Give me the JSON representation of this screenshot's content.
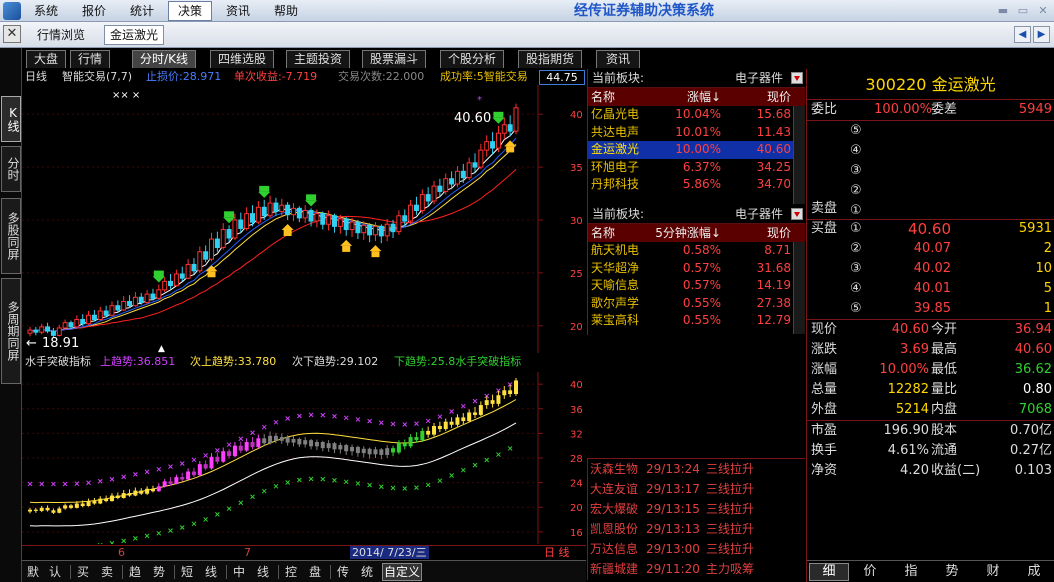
{
  "menubar": {
    "items": [
      "系统",
      "报价",
      "统计",
      "决策",
      "资讯",
      "帮助"
    ],
    "active_index": 3,
    "title": "经传证券辅助决策系统"
  },
  "toolbar": {
    "tabs": [
      "行情浏览",
      "金运激光"
    ],
    "active_index": 1
  },
  "left_tabs": [
    "K线",
    "分时",
    "多股同屏",
    "多周期同屏"
  ],
  "top_tabs": {
    "items": [
      "大盘",
      "行情",
      "分时/K线",
      "四维选股",
      "主题投资",
      "股票漏斗",
      "个股分析",
      "股指期货",
      "资讯"
    ],
    "active_index": 2
  },
  "chart_header": {
    "period": "日线",
    "indicator": "智能交易(7,7)",
    "stop_profit": "止损价:28.971",
    "single_gain": "单次收益:-7.719",
    "trade_count": "交易次数:22.000",
    "success_rate": "成功率:5智能交易",
    "price_box": "44.75"
  },
  "indicator_header": {
    "name": "水手突破指标",
    "up": "上趋势:36.851",
    "sub_up": "次上趋势:33.780",
    "sub_down": "次下趋势:29.102",
    "down": "下趋势:25.8水手突破指标"
  },
  "chart_data": [
    {
      "type": "candlestick",
      "title": "日线",
      "y_ticks": [
        "40",
        "35",
        "30",
        "25",
        "20"
      ],
      "ylim": [
        18,
        42
      ],
      "annotations": {
        "high_label": "40.60",
        "low_label": "18.91",
        "marks": "×× ×"
      },
      "candles": [
        [
          19.3,
          19.6,
          19.0,
          19.9
        ],
        [
          19.6,
          19.4,
          19.1,
          19.9
        ],
        [
          19.4,
          19.9,
          19.2,
          20.2
        ],
        [
          19.9,
          19.5,
          19.3,
          20.3
        ],
        [
          19.5,
          19.1,
          18.9,
          19.8
        ],
        [
          19.1,
          19.8,
          19.0,
          20.1
        ],
        [
          19.8,
          20.3,
          19.6,
          20.6
        ],
        [
          20.3,
          19.9,
          19.7,
          20.5
        ],
        [
          19.9,
          20.6,
          19.8,
          21.0
        ],
        [
          20.6,
          20.2,
          20.0,
          21.1
        ],
        [
          20.2,
          21.0,
          20.1,
          21.4
        ],
        [
          21.0,
          20.6,
          20.4,
          21.5
        ],
        [
          20.6,
          21.4,
          20.5,
          21.8
        ],
        [
          21.4,
          21.0,
          20.8,
          21.9
        ],
        [
          21.0,
          21.9,
          20.9,
          22.3
        ],
        [
          21.9,
          21.5,
          21.3,
          22.4
        ],
        [
          21.5,
          22.3,
          21.4,
          22.8
        ],
        [
          22.3,
          21.9,
          21.7,
          22.9
        ],
        [
          21.9,
          22.7,
          21.8,
          23.2
        ],
        [
          22.7,
          22.2,
          22.0,
          23.1
        ],
        [
          22.2,
          23.0,
          22.0,
          23.4
        ],
        [
          23.0,
          22.6,
          22.4,
          23.5
        ],
        [
          22.6,
          23.4,
          22.5,
          23.9
        ],
        [
          23.4,
          24.2,
          23.2,
          24.6
        ],
        [
          24.2,
          23.8,
          23.5,
          24.9
        ],
        [
          23.8,
          24.9,
          23.7,
          25.3
        ],
        [
          24.9,
          24.5,
          24.2,
          25.6
        ],
        [
          24.5,
          25.8,
          24.4,
          26.3
        ],
        [
          25.8,
          25.2,
          24.9,
          26.4
        ],
        [
          25.2,
          27.0,
          25.0,
          27.5
        ],
        [
          27.0,
          26.3,
          26.0,
          27.6
        ],
        [
          26.3,
          28.2,
          26.1,
          28.8
        ],
        [
          28.2,
          27.4,
          27.0,
          28.9
        ],
        [
          27.4,
          29.1,
          27.2,
          29.7
        ],
        [
          29.1,
          28.3,
          27.9,
          29.5
        ],
        [
          28.3,
          30.0,
          28.1,
          30.6
        ],
        [
          30.0,
          29.2,
          28.8,
          30.7
        ],
        [
          29.2,
          30.6,
          29.0,
          31.2
        ],
        [
          30.6,
          29.8,
          29.4,
          31.4
        ],
        [
          29.8,
          31.2,
          29.6,
          31.8
        ],
        [
          31.2,
          30.4,
          30.0,
          31.9
        ],
        [
          30.4,
          31.6,
          30.2,
          32.3
        ],
        [
          31.6,
          30.8,
          30.4,
          32.1
        ],
        [
          30.8,
          31.4,
          30.3,
          32.0
        ],
        [
          31.4,
          30.5,
          30.0,
          31.7
        ],
        [
          30.5,
          31.1,
          29.9,
          31.6
        ],
        [
          31.1,
          30.2,
          29.8,
          31.3
        ],
        [
          30.2,
          30.9,
          29.7,
          31.4
        ],
        [
          30.9,
          29.9,
          29.4,
          31.1
        ],
        [
          29.9,
          30.6,
          29.3,
          31.0
        ],
        [
          30.6,
          29.6,
          29.1,
          30.8
        ],
        [
          29.6,
          30.4,
          29.0,
          30.9
        ],
        [
          30.4,
          29.4,
          28.8,
          30.6
        ],
        [
          29.4,
          30.1,
          28.7,
          30.5
        ],
        [
          30.1,
          29.1,
          28.5,
          30.3
        ],
        [
          29.1,
          29.8,
          28.4,
          30.2
        ],
        [
          29.8,
          28.8,
          28.2,
          30.0
        ],
        [
          28.8,
          29.5,
          28.1,
          29.9
        ],
        [
          29.5,
          28.6,
          27.9,
          29.7
        ],
        [
          28.6,
          29.4,
          28.0,
          29.8
        ],
        [
          29.4,
          28.5,
          27.8,
          29.6
        ],
        [
          28.5,
          29.6,
          28.0,
          30.1
        ],
        [
          29.6,
          28.9,
          28.3,
          30.0
        ],
        [
          28.9,
          30.4,
          28.6,
          30.9
        ],
        [
          30.4,
          29.9,
          29.4,
          31.0
        ],
        [
          29.9,
          31.4,
          29.6,
          31.9
        ],
        [
          31.4,
          30.9,
          30.5,
          32.2
        ],
        [
          30.9,
          32.4,
          30.6,
          32.9
        ],
        [
          32.4,
          31.8,
          31.3,
          33.1
        ],
        [
          31.8,
          33.2,
          31.5,
          33.7
        ],
        [
          33.2,
          32.7,
          32.2,
          33.9
        ],
        [
          32.7,
          33.9,
          32.4,
          34.4
        ],
        [
          33.9,
          33.4,
          32.9,
          34.6
        ],
        [
          33.4,
          34.6,
          33.1,
          35.1
        ],
        [
          34.6,
          34.0,
          33.5,
          35.3
        ],
        [
          34.0,
          35.4,
          33.8,
          35.9
        ],
        [
          35.4,
          35.0,
          34.5,
          36.3
        ],
        [
          35.0,
          36.6,
          34.8,
          37.2
        ],
        [
          36.6,
          37.4,
          36.0,
          38.0
        ],
        [
          37.4,
          36.8,
          36.2,
          38.3
        ],
        [
          36.8,
          38.2,
          36.4,
          38.9
        ],
        [
          38.2,
          39.0,
          37.6,
          39.7
        ],
        [
          39.0,
          38.4,
          37.9,
          39.9
        ],
        [
          38.4,
          40.6,
          38.1,
          41.0
        ]
      ]
    },
    {
      "type": "line",
      "title": "水手突破指标",
      "y_ticks": [
        "40",
        "36",
        "32",
        "28",
        "24",
        "20",
        "16"
      ],
      "ylim": [
        15,
        41
      ],
      "series": [
        {
          "name": "上趋势"
        },
        {
          "name": "次上趋势"
        },
        {
          "name": "次下趋势"
        },
        {
          "name": "下趋势"
        }
      ]
    }
  ],
  "date_bar": {
    "ticks": [
      "6",
      "7"
    ],
    "current": "2014/ 7/23/三",
    "period_label": "日 线"
  },
  "bottom_tabs": [
    "默",
    "认",
    "买",
    "卖",
    "趋",
    "势",
    "短",
    "线",
    "中",
    "线",
    "控",
    "盘",
    "传",
    "统",
    "自定义"
  ],
  "sector1": {
    "label": "当前板块:",
    "selected": "电子器件",
    "col_name": "名称",
    "col_change": "涨幅↓",
    "col_price": "现价",
    "rows": [
      {
        "name": "亿晶光电",
        "change": "10.04%",
        "price": "15.68"
      },
      {
        "name": "共达电声",
        "change": "10.01%",
        "price": "11.43"
      },
      {
        "name": "金运激光",
        "change": "10.00%",
        "price": "40.60"
      },
      {
        "name": "环旭电子",
        "change": "6.37%",
        "price": "34.25"
      },
      {
        "name": "丹邦科技",
        "change": "5.86%",
        "price": "34.70"
      }
    ],
    "selected_index": 2
  },
  "sector2": {
    "label": "当前板块:",
    "selected": "电子器件",
    "col_name": "名称",
    "col_change": "5分钟涨幅↓",
    "col_price": "现价",
    "rows": [
      {
        "name": "航天机电",
        "change": "0.58%",
        "price": "8.71"
      },
      {
        "name": "天华超净",
        "change": "0.57%",
        "price": "31.68"
      },
      {
        "name": "天喻信息",
        "change": "0.57%",
        "price": "14.19"
      },
      {
        "name": "歌尔声学",
        "change": "0.55%",
        "price": "27.38"
      },
      {
        "name": "莱宝高科",
        "change": "0.55%",
        "price": "12.79"
      }
    ]
  },
  "alerts": [
    {
      "name": "沃森生物",
      "time": "29/13:24",
      "signal": "三线拉升"
    },
    {
      "name": "大连友谊",
      "time": "29/13:17",
      "signal": "三线拉升"
    },
    {
      "name": "宏大爆破",
      "time": "29/13:15",
      "signal": "三线拉升"
    },
    {
      "name": "凯恩股份",
      "time": "29/13:13",
      "signal": "三线拉升"
    },
    {
      "name": "万达信息",
      "time": "29/13:00",
      "signal": "三线拉升"
    },
    {
      "name": "新疆城建",
      "time": "29/11:20",
      "signal": "主力吸筹"
    }
  ],
  "quote": {
    "title": "300220  金运激光",
    "weibi_label": "委比",
    "weibi_value": "100.00%",
    "weicha_label": "委差",
    "weicha_value": "5949",
    "sell_label": "卖盘",
    "buy_label": "买盘",
    "sell_levels": [
      "⑤",
      "④",
      "③",
      "②",
      "①"
    ],
    "buy_levels": [
      {
        "lvl": "①",
        "price": "40.60",
        "vol": "5931"
      },
      {
        "lvl": "②",
        "price": "40.07",
        "vol": "2"
      },
      {
        "lvl": "③",
        "price": "40.02",
        "vol": "10"
      },
      {
        "lvl": "④",
        "price": "40.01",
        "vol": "5"
      },
      {
        "lvl": "⑤",
        "price": "39.85",
        "vol": "1"
      }
    ],
    "stats1": [
      {
        "l1": "现价",
        "v1": "40.60",
        "l2": "今开",
        "v2": "36.94",
        "c2": "#ff4040"
      },
      {
        "l1": "涨跌",
        "v1": "3.69",
        "l2": "最高",
        "v2": "40.60",
        "c2": "#ff4040"
      },
      {
        "l1": "涨幅",
        "v1": "10.00%",
        "l2": "最低",
        "v2": "36.62",
        "c2": "#30d030"
      },
      {
        "l1": "总量",
        "v1": "12282",
        "l2": "量比",
        "v2": "0.80",
        "c2": "#ffffff",
        "c1": "#ffd700"
      },
      {
        "l1": "外盘",
        "v1": "5214",
        "l2": "内盘",
        "v2": "7068",
        "c2": "#30d030",
        "c1": "#ffd700"
      }
    ],
    "stats2": [
      {
        "l1": "市盈",
        "v1": "196.90",
        "l2": "股本",
        "v2": "0.70亿"
      },
      {
        "l1": "换手",
        "v1": "4.61%",
        "l2": "流通",
        "v2": "0.27亿"
      },
      {
        "l1": "净资",
        "v1": "4.20",
        "l2": "收益(二)",
        "v2": "0.103"
      }
    ],
    "tabs": [
      "细",
      "价",
      "指",
      "势",
      "财",
      "成"
    ],
    "active_tab": 0
  }
}
